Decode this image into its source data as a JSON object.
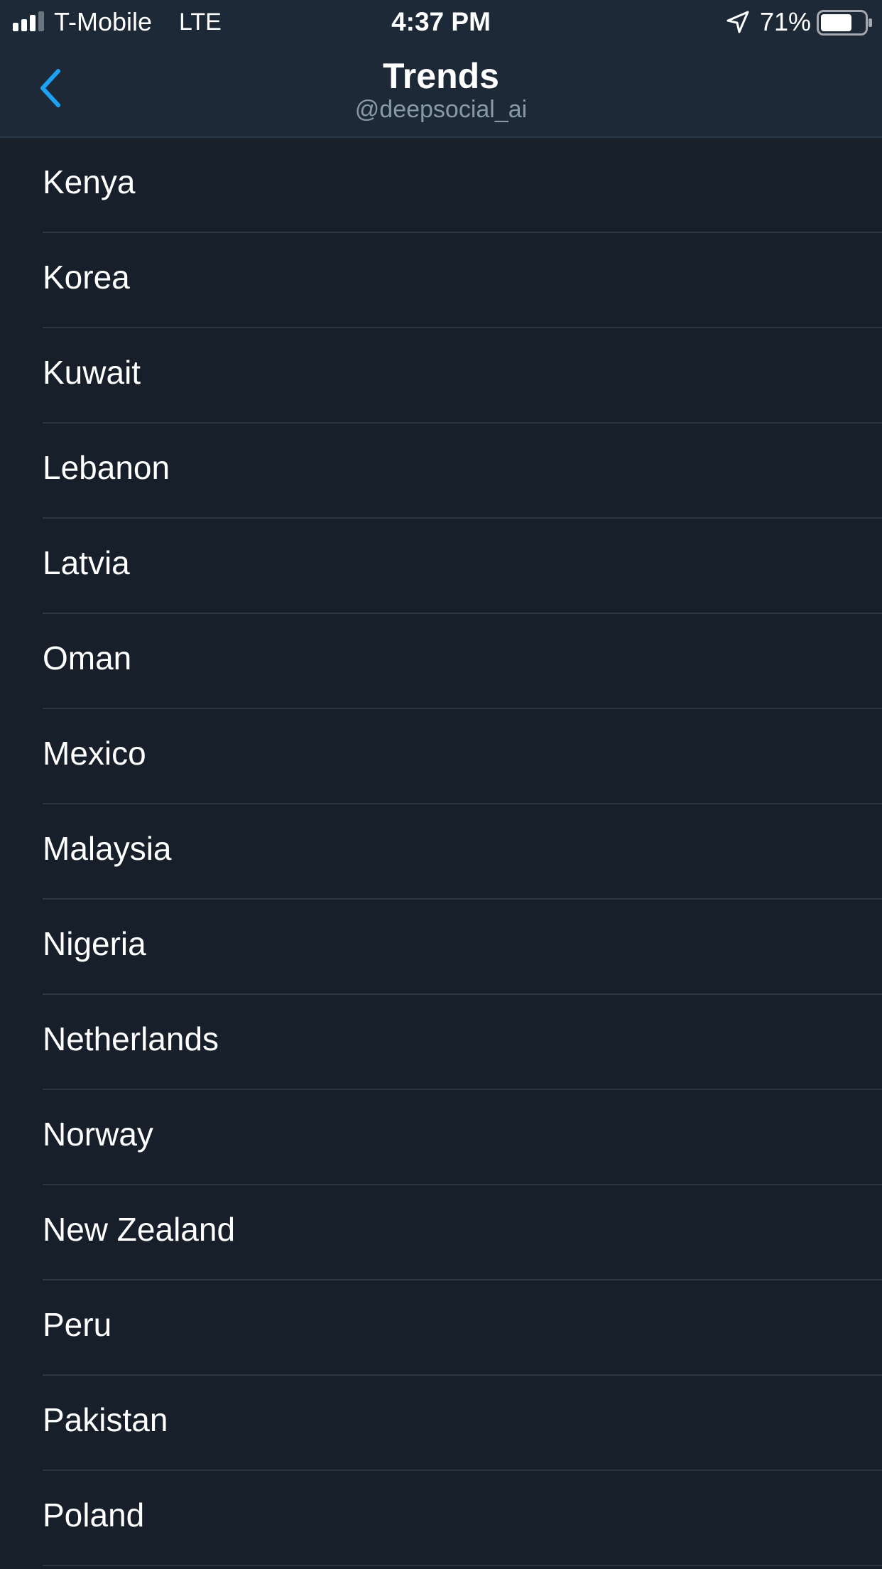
{
  "status_bar": {
    "carrier": "T-Mobile",
    "network": "LTE",
    "time": "4:37 PM",
    "battery_percent": "71%",
    "battery_level": 0.71,
    "signal_icon": "signal-bars-icon",
    "location_icon": "location-arrow-icon",
    "battery_icon": "battery-icon"
  },
  "header": {
    "title": "Trends",
    "subtitle": "@deepsocial_ai",
    "back_icon": "chevron-left-icon"
  },
  "colors": {
    "background": "#17202a",
    "header_background": "#1e2938",
    "accent": "#1da1f2",
    "subtitle": "#8899a6",
    "divider": "#2c3642"
  },
  "countries": [
    "Kenya",
    "Korea",
    "Kuwait",
    "Lebanon",
    "Latvia",
    "Oman",
    "Mexico",
    "Malaysia",
    "Nigeria",
    "Netherlands",
    "Norway",
    "New Zealand",
    "Peru",
    "Pakistan",
    "Poland"
  ]
}
